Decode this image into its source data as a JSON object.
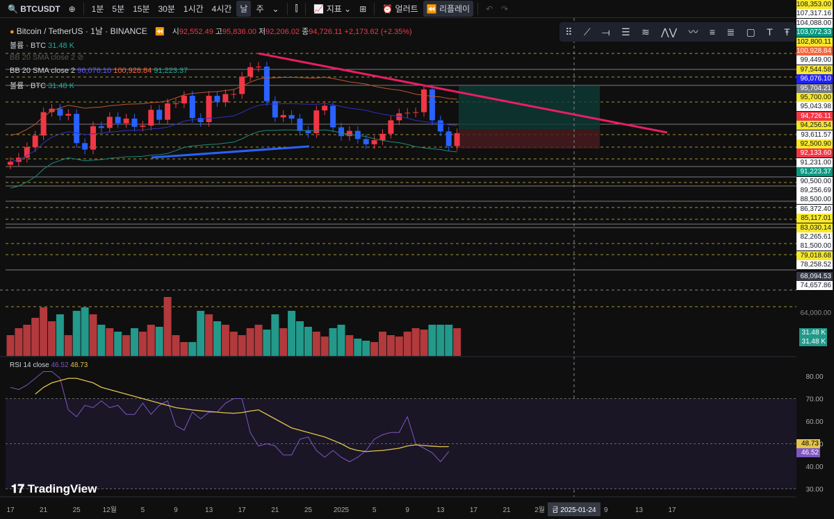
{
  "toolbar": {
    "symbol": "BTCUSDT",
    "intervals": [
      "1분",
      "5분",
      "15분",
      "30분",
      "1시간",
      "4시간",
      "날",
      "주"
    ],
    "active_interval": "날",
    "indicators": "지표",
    "alert": "얼러트",
    "replay": "리플레이"
  },
  "legend": {
    "title": "Bitcoin / TetherUS · 1날 · BINANCE",
    "o_label": "시",
    "o": "92,552.49",
    "h_label": "고",
    "h": "95,836.00",
    "l_label": "저",
    "l": "92,206.02",
    "c_label": "종",
    "c": "94,726.11",
    "change": "+2,173.62 (+2.35%)",
    "vol1": "볼륨 · BTC",
    "vol1_val": "31.48 K",
    "bb_hidden": "BB 20 SMA close 2",
    "bb": "BB 20 SMA close 2",
    "bb_mid": "96,076.10",
    "bb_up": "100,928.84",
    "bb_low": "91,223.37",
    "vol2": "볼륨 · BTC",
    "vol2_val": "31.48 K"
  },
  "rsi": {
    "label": "RSI 14 close",
    "value": "46.52",
    "ma": "48.73",
    "ticks": [
      "80.00",
      "70.00",
      "60.00",
      "50.00",
      "40.00",
      "30.00"
    ]
  },
  "price_labels": [
    {
      "t": "108,353.00",
      "bg": "#f7e82a"
    },
    {
      "t": "107,317.16",
      "bg": "#ffffff"
    },
    {
      "t": "104,088.00",
      "bg": "#ffffff"
    },
    {
      "t": "103,072.33",
      "bg": "#089981"
    },
    {
      "t": "102,800.11",
      "bg": "#f7e82a"
    },
    {
      "t": "100,928.84",
      "bg": "#f7643c"
    },
    {
      "t": "99,449.00",
      "bg": "#ffffff"
    },
    {
      "t": "97,544.58",
      "bg": "#f7e82a"
    },
    {
      "t": "96,076.10",
      "bg": "#2121ff"
    },
    {
      "t": "95,704.21",
      "bg": "#787b86"
    },
    {
      "t": "95,700.00",
      "bg": "#f7e82a"
    },
    {
      "t": "95,043.98",
      "bg": "#ffffff"
    },
    {
      "t": "94,726.11",
      "bg": "#f23645"
    },
    {
      "t": "94,256.54",
      "bg": "#f7e82a"
    },
    {
      "t": "93,611.57",
      "bg": "#ffffff"
    },
    {
      "t": "92,500.90",
      "bg": "#f7e82a"
    },
    {
      "t": "92,133.60",
      "bg": "#f23645"
    },
    {
      "t": "91,231.00",
      "bg": "#ffffff"
    },
    {
      "t": "91,223.37",
      "bg": "#089981"
    },
    {
      "t": "90,500.00",
      "bg": "#ffffff"
    },
    {
      "t": "89,256.69",
      "bg": "#ffffff"
    },
    {
      "t": "88,500.00",
      "bg": "#ffffff"
    },
    {
      "t": "86,372.40",
      "bg": "#ffffff"
    },
    {
      "t": "85,117.01",
      "bg": "#f7e82a"
    },
    {
      "t": "83,030.14",
      "bg": "#f7e82a"
    },
    {
      "t": "82,265.61",
      "bg": "#ffffff"
    },
    {
      "t": "81,500.00",
      "bg": "#ffffff"
    },
    {
      "t": "79,018.68",
      "bg": "#f7e82a"
    },
    {
      "t": "78,258.52",
      "bg": "#ffffff"
    },
    {
      "t": "68,094.53",
      "bg": "#363a45"
    },
    {
      "t": "74,657.86",
      "bg": "#ffffff"
    }
  ],
  "price_tick": "64,000.00",
  "vol_labels": [
    "31.48 K",
    "31.48 K"
  ],
  "x_ticks": [
    "17",
    "21",
    "25",
    "12월",
    "5",
    "9",
    "13",
    "17",
    "21",
    "25",
    "2025",
    "5",
    "9",
    "13",
    "17",
    "21",
    "2월",
    "5",
    "9",
    "13",
    "17"
  ],
  "crosshair_date": "금 2025-01-24",
  "brand": "TradingView",
  "closes": [
    89.8,
    90.5,
    92.3,
    94.3,
    98.3,
    98.9,
    97.7,
    98.0,
    93.0,
    91.9,
    95.9,
    95.6,
    97.5,
    96.4,
    97.2,
    95.8,
    96.0,
    98.7,
    97.0,
    99.8,
    99.8,
    101.1,
    97.3,
    96.6,
    101.1,
    100.0,
    101.4,
    101.4,
    104.4,
    106.0,
    106.1,
    100.2,
    97.4,
    97.8,
    97.2,
    95.1,
    94.7,
    98.6,
    99.4,
    95.7,
    94.2,
    95.1,
    93.7,
    92.8,
    93.5,
    94.6,
    96.9,
    98.1,
    98.2,
    98.3,
    102.2,
    96.9,
    95.0,
    92.5,
    94.7
  ],
  "volumes": [
    30,
    40,
    45,
    55,
    70,
    50,
    60,
    30,
    65,
    70,
    60,
    45,
    40,
    35,
    30,
    40,
    35,
    45,
    42,
    85,
    30,
    20,
    20,
    65,
    60,
    50,
    45,
    35,
    30,
    40,
    45,
    38,
    60,
    40,
    65,
    50,
    42,
    35,
    28,
    40,
    45,
    30,
    25,
    22,
    20,
    35,
    30,
    28,
    35,
    40,
    38,
    45,
    45,
    45,
    40
  ],
  "rsi_values": [
    75,
    74,
    76,
    79,
    82,
    82,
    79,
    65,
    62,
    67,
    66,
    69,
    66,
    67,
    63,
    63,
    68,
    63,
    67,
    69,
    58,
    56,
    64,
    61,
    64,
    64,
    68,
    70,
    70,
    55,
    49,
    50,
    49,
    45,
    45,
    52,
    53,
    47,
    44,
    47,
    44,
    42,
    44,
    47,
    52,
    54,
    55,
    55,
    62,
    50,
    48,
    46,
    42,
    46.5
  ],
  "rsi_ma": [
    72,
    75,
    77,
    78,
    79,
    79,
    78,
    77,
    75,
    74,
    73,
    72,
    71,
    70,
    69,
    68,
    67,
    66,
    65.5,
    65,
    64.6,
    64.3,
    64,
    63.7,
    63.5,
    63.8,
    64.5,
    65,
    63,
    61,
    59,
    57,
    56,
    55,
    54,
    53,
    51.5,
    50,
    48,
    47,
    46.5,
    46.8,
    47,
    47.5,
    48,
    49,
    49.5,
    49.2,
    48.9,
    48.7,
    48.73
  ],
  "colors": {
    "up": "#f23645",
    "down": "#2962ff",
    "vol_up": "#b2393c",
    "vol_down": "#22998a",
    "trend": "#e91e63",
    "rsi": "#7e57c2",
    "rsi_ma": "#e3c44a"
  }
}
